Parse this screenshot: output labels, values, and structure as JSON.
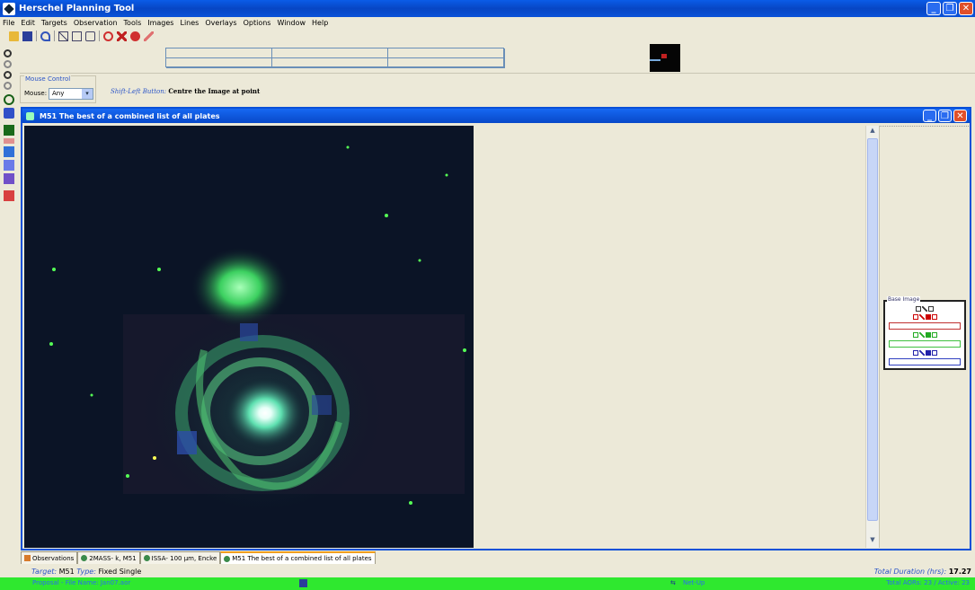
{
  "app": {
    "title": "Herschel Planning Tool"
  },
  "window_buttons": {
    "minimize": "_",
    "restore": "❐",
    "close": "✕"
  },
  "menu": [
    "File",
    "Edit",
    "Targets",
    "Observation",
    "Tools",
    "Images",
    "Lines",
    "Overlays",
    "Options",
    "Window",
    "Help"
  ],
  "toolbar_icons": [
    "open-icon",
    "save-icon",
    "undo-icon",
    "tool-x-icon",
    "tool-frame-icon",
    "tool-doc-icon",
    "target-icon",
    "delete-icon",
    "info-icon",
    "edit-icon"
  ],
  "left_tools": [
    "zoom-in-icon",
    "zoom-out-icon",
    "zoom-fit-icon",
    "zoom-reset-icon",
    "crosshair-icon",
    "target-circle-icon",
    "grid-icon",
    "ruler-icon",
    "layers-icon",
    "overlay-icon",
    "pen-icon",
    "flag-icon"
  ],
  "mouse_control": {
    "legend": "Mouse Control",
    "label": "Mouse:",
    "value": "Any",
    "hint_key": "Shift-Left Button:",
    "hint_value": "Centre the Image at point"
  },
  "image_frame": {
    "title": "M51  The best of a combined list of all plates"
  },
  "base_image": {
    "legend": "Base Image"
  },
  "tabs": [
    {
      "label": "Observations",
      "active": false
    },
    {
      "label": "2MASS- k,  M51",
      "active": false
    },
    {
      "label": "ISSA- 100 µm,  Encke",
      "active": false
    },
    {
      "label": "M51  The best of a combined list of all plates",
      "active": true
    }
  ],
  "target_line": {
    "target_key": "Target:",
    "target_value": "M51",
    "type_key": "Type:",
    "type_value": "Fixed Single",
    "duration_key": "Total Duration (hrs):",
    "duration_value": "17.27"
  },
  "status": {
    "left": "Proposal - File Name: Jan07.aor",
    "center": "Net-Up",
    "right": "Total AORs: 23  / Active: 23"
  },
  "colors": {
    "title_blue": "#0a50d8",
    "status_green": "#2fe82f",
    "accent_blue": "#2b55c8"
  }
}
